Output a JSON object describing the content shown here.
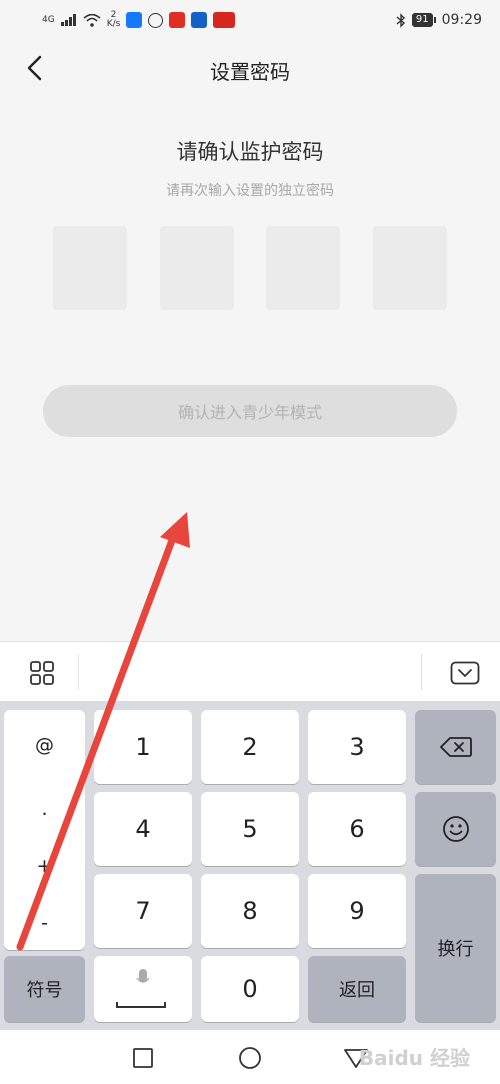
{
  "status_bar": {
    "network": "4G",
    "speed_value": "2",
    "speed_unit": "K/s",
    "battery": "91",
    "time": "09:29",
    "icons": [
      "signal-icon",
      "wifi-icon",
      "alipay-icon",
      "app-icon",
      "red-app-icon",
      "news-app-icon",
      "bluetooth-icon",
      "battery-icon"
    ]
  },
  "nav": {
    "title": "设置密码",
    "back_icon": "chevron-left-icon"
  },
  "content": {
    "heading": "请确认监护密码",
    "subheading": "请再次输入设置的独立密码",
    "pin_boxes": [
      "",
      "",
      "",
      ""
    ],
    "confirm_button": "确认进入青少年模式"
  },
  "keyboard": {
    "toolbar_icons": [
      "grid-icon",
      "collapse-keyboard-icon"
    ],
    "symbols": [
      "@",
      ".",
      "+",
      "-"
    ],
    "digits": [
      "1",
      "2",
      "3",
      "4",
      "5",
      "6",
      "7",
      "8",
      "9",
      "0"
    ],
    "symbol_key": "符号",
    "back_key": "返回",
    "enter_key": "换行",
    "delete_icon": "backspace-icon",
    "emoji_icon": "emoji-icon",
    "space_icon": "mic-icon"
  },
  "system_nav": {
    "icons": [
      "recent-apps-icon",
      "home-icon",
      "back-triangle-icon"
    ],
    "watermark": "Baidu 经验"
  },
  "colors": {
    "background": "#f5f5f5",
    "keyboard_bg": "#d9dbe0",
    "function_key": "#aeb3be",
    "annotation_arrow": "#e8453c"
  }
}
